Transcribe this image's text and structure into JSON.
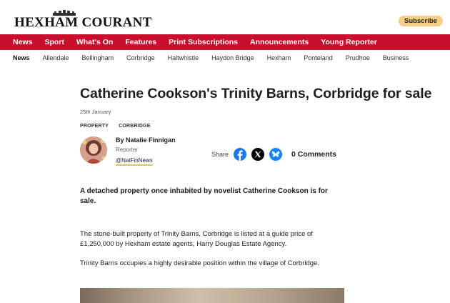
{
  "masthead": {
    "title": "HEXHAM COURANT"
  },
  "header": {
    "subscribe_label": "Subscribe"
  },
  "main_nav": [
    "News",
    "Sport",
    "What's On",
    "Features",
    "Print Subscriptions",
    "Announcements",
    "Young Reporter"
  ],
  "sub_nav": [
    "News",
    "Allendale",
    "Bellingham",
    "Corbridge",
    "Haltwhistle",
    "Haydon Bridge",
    "Hexham",
    "Ponteland",
    "Prudhoe",
    "Business"
  ],
  "article": {
    "headline": "Catherine Cookson's Trinity Barns, Corbridge for sale",
    "date": "25th January",
    "tags": [
      "PROPERTY",
      "CORBRIDGE"
    ],
    "author": {
      "name": "By Natalie Finnigan",
      "role": "Reporter",
      "handle": "@NatFinNews"
    },
    "share_label": "Share",
    "comments_label": "0 Comments",
    "standfirst": "A detached property once inhabited by novelist Catherine Cookson is for sale.",
    "paragraphs": [
      "The stone-built property of Trinity Barns, Corbridge is listed at a guide price of £1,250,000 by Hexham estate agents, Harry Douglas Estate Agency.",
      "Trinity Barns occupies a highly desirable position within the village of Corbridge."
    ]
  },
  "colors": {
    "brand_red": "#c8102e",
    "subscribe_bg": "#f7ce86",
    "facebook": "#1877f2",
    "bluesky": "#1185fe"
  }
}
